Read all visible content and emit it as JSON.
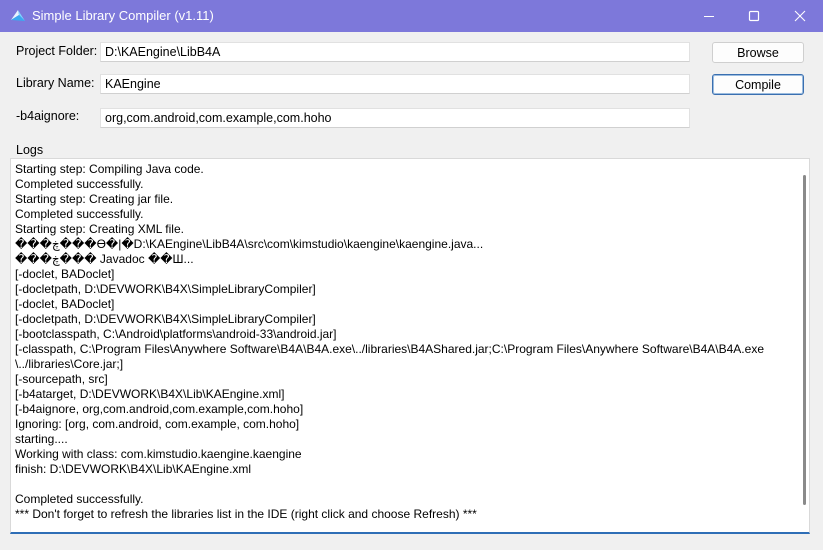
{
  "window": {
    "title": "Simple Library Compiler (v1.11)",
    "accent_color": "#7d78da"
  },
  "form": {
    "project_folder": {
      "label": "Project Folder:",
      "value": "D:\\KAEngine\\LibB4A"
    },
    "library_name": {
      "label": "Library Name:",
      "value": "KAEngine"
    },
    "b4aignore": {
      "label": "-b4aignore:",
      "value": "org,com.android,com.example,com.hoho"
    }
  },
  "buttons": {
    "browse": "Browse",
    "compile": "Compile"
  },
  "logs": {
    "label": "Logs",
    "lines": [
      "Starting step: Compiling Java code.",
      "Completed successfully.",
      "Starting step: Creating jar file.",
      "Completed successfully.",
      "Starting step: Creating XML file.",
      "���ڿ���ϴ�|�D:\\KAEngine\\LibB4A\\src\\com\\kimstudio\\kaengine\\kaengine.java...",
      "���ڿ��� Javadoc ��Ш...",
      "[-doclet, BADoclet]",
      "[-docletpath, D:\\DEVWORK\\B4X\\SimpleLibraryCompiler]",
      "[-doclet, BADoclet]",
      "[-docletpath, D:\\DEVWORK\\B4X\\SimpleLibraryCompiler]",
      "[-bootclasspath, C:\\Android\\platforms\\android-33\\android.jar]",
      "[-classpath, C:\\Program Files\\Anywhere Software\\B4A\\B4A.exe\\../libraries\\B4AShared.jar;C:\\Program Files\\Anywhere Software\\B4A\\B4A.exe",
      "\\../libraries\\Core.jar;]",
      "[-sourcepath, src]",
      "[-b4atarget, D:\\DEVWORK\\B4X\\Lib\\KAEngine.xml]",
      "[-b4aignore, org,com.android,com.example,com.hoho]",
      "Ignoring: [org, com.android, com.example, com.hoho]",
      "starting....",
      "Working with class: com.kimstudio.kaengine.kaengine",
      "finish: D:\\DEVWORK\\B4X\\Lib\\KAEngine.xml",
      "",
      "Completed successfully.",
      "*** Don't forget to refresh the libraries list in the IDE (right click and choose Refresh) ***"
    ]
  }
}
